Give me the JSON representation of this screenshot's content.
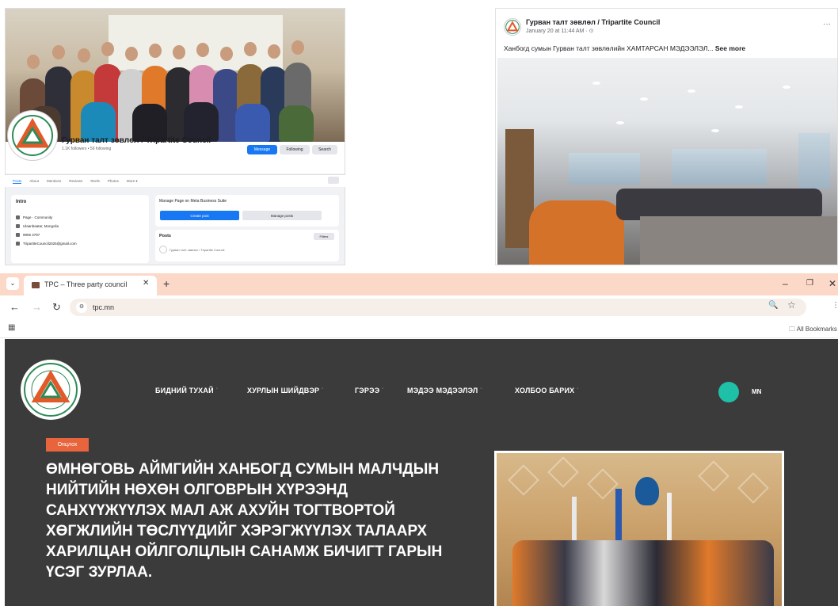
{
  "facebook_page": {
    "title": "Гурван талт зөвлөл / Tripartite Council",
    "followers": "1.1K followers • 56 following",
    "buttons": {
      "message": "Message",
      "following": "Following",
      "search": "Search"
    },
    "tabs": [
      "Posts",
      "About",
      "Mentions",
      "Reviews",
      "Reels",
      "Photos",
      "More ▾"
    ],
    "intro": {
      "heading": "Intro",
      "rows": [
        "Page · Community",
        "Ulaanbaatar, Mongolia",
        "9906 3797",
        "TripartiteCouncil2025@gmail.com"
      ]
    },
    "manage": {
      "title": "Manage Page on Meta Business Suite",
      "create_post": "Create post",
      "manage_posts": "Manage posts"
    },
    "posts": {
      "heading": "Posts",
      "filters": "Filters",
      "preview": "Гурван талт зөвлөл / Tripartite Council"
    }
  },
  "facebook_post": {
    "author": "Гурван талт зөвлөл / Tripartite Council",
    "date": "January 20 at 11:44 AM · ",
    "text": "Ханбогд сумын Гурван талт зөвлөлийн ХАМТАРСАН МЭДЭЭЛЭЛ...",
    "see_more": "See more",
    "more": "···"
  },
  "browser": {
    "tab_title": "TPC – Three party council",
    "url": "tpc.mn",
    "all_bookmarks": "All Bookmarks"
  },
  "site": {
    "nav": [
      "БИДНИЙ ТУХАЙ",
      "ХУРЛЫН ШИЙДВЭР",
      "ГЭРЭЭ",
      "МЭДЭЭ МЭДЭЭЛЭЛ",
      "ХОЛБОО БАРИХ"
    ],
    "lang": "MN",
    "badge": "Онцлох",
    "headline": "ӨМНӨГОВЬ АЙМГИЙН ХАНБОГД СУМЫН МАЛЧДЫН НИЙТИЙН НӨХӨН ОЛГОВРЫН ХҮРЭЭНД САНХҮҮЖҮҮЛЭХ МАЛ АЖ АХУЙН ТОГТВОРТОЙ ХӨГЖЛИЙН ТӨСЛҮҮДИЙГ ХЭРЭГЖҮҮЛЭХ ТАЛААРХ ХАРИЛЦАН ОЙЛГОЛЦЛЫН САНАМЖ БИЧИГТ ГАРЫН ҮСЭГ ЗУРЛАА."
  },
  "colors": {
    "fb_blue": "#1877f2",
    "tab_strip": "#fbd8c8",
    "site_bg": "#3b3b3b",
    "accent_teal": "#1fc0a8",
    "badge_orange": "#e8643c"
  }
}
